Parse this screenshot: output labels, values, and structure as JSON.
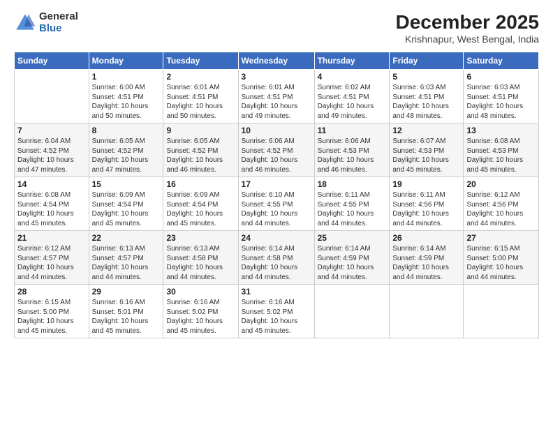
{
  "logo": {
    "general": "General",
    "blue": "Blue"
  },
  "header": {
    "month_year": "December 2025",
    "location": "Krishnapur, West Bengal, India"
  },
  "days_of_week": [
    "Sunday",
    "Monday",
    "Tuesday",
    "Wednesday",
    "Thursday",
    "Friday",
    "Saturday"
  ],
  "weeks": [
    [
      {
        "day": "",
        "info": ""
      },
      {
        "day": "1",
        "info": "Sunrise: 6:00 AM\nSunset: 4:51 PM\nDaylight: 10 hours\nand 50 minutes."
      },
      {
        "day": "2",
        "info": "Sunrise: 6:01 AM\nSunset: 4:51 PM\nDaylight: 10 hours\nand 50 minutes."
      },
      {
        "day": "3",
        "info": "Sunrise: 6:01 AM\nSunset: 4:51 PM\nDaylight: 10 hours\nand 49 minutes."
      },
      {
        "day": "4",
        "info": "Sunrise: 6:02 AM\nSunset: 4:51 PM\nDaylight: 10 hours\nand 49 minutes."
      },
      {
        "day": "5",
        "info": "Sunrise: 6:03 AM\nSunset: 4:51 PM\nDaylight: 10 hours\nand 48 minutes."
      },
      {
        "day": "6",
        "info": "Sunrise: 6:03 AM\nSunset: 4:51 PM\nDaylight: 10 hours\nand 48 minutes."
      }
    ],
    [
      {
        "day": "7",
        "info": "Sunrise: 6:04 AM\nSunset: 4:52 PM\nDaylight: 10 hours\nand 47 minutes."
      },
      {
        "day": "8",
        "info": "Sunrise: 6:05 AM\nSunset: 4:52 PM\nDaylight: 10 hours\nand 47 minutes."
      },
      {
        "day": "9",
        "info": "Sunrise: 6:05 AM\nSunset: 4:52 PM\nDaylight: 10 hours\nand 46 minutes."
      },
      {
        "day": "10",
        "info": "Sunrise: 6:06 AM\nSunset: 4:52 PM\nDaylight: 10 hours\nand 46 minutes."
      },
      {
        "day": "11",
        "info": "Sunrise: 6:06 AM\nSunset: 4:53 PM\nDaylight: 10 hours\nand 46 minutes."
      },
      {
        "day": "12",
        "info": "Sunrise: 6:07 AM\nSunset: 4:53 PM\nDaylight: 10 hours\nand 45 minutes."
      },
      {
        "day": "13",
        "info": "Sunrise: 6:08 AM\nSunset: 4:53 PM\nDaylight: 10 hours\nand 45 minutes."
      }
    ],
    [
      {
        "day": "14",
        "info": "Sunrise: 6:08 AM\nSunset: 4:54 PM\nDaylight: 10 hours\nand 45 minutes."
      },
      {
        "day": "15",
        "info": "Sunrise: 6:09 AM\nSunset: 4:54 PM\nDaylight: 10 hours\nand 45 minutes."
      },
      {
        "day": "16",
        "info": "Sunrise: 6:09 AM\nSunset: 4:54 PM\nDaylight: 10 hours\nand 45 minutes."
      },
      {
        "day": "17",
        "info": "Sunrise: 6:10 AM\nSunset: 4:55 PM\nDaylight: 10 hours\nand 44 minutes."
      },
      {
        "day": "18",
        "info": "Sunrise: 6:11 AM\nSunset: 4:55 PM\nDaylight: 10 hours\nand 44 minutes."
      },
      {
        "day": "19",
        "info": "Sunrise: 6:11 AM\nSunset: 4:56 PM\nDaylight: 10 hours\nand 44 minutes."
      },
      {
        "day": "20",
        "info": "Sunrise: 6:12 AM\nSunset: 4:56 PM\nDaylight: 10 hours\nand 44 minutes."
      }
    ],
    [
      {
        "day": "21",
        "info": "Sunrise: 6:12 AM\nSunset: 4:57 PM\nDaylight: 10 hours\nand 44 minutes."
      },
      {
        "day": "22",
        "info": "Sunrise: 6:13 AM\nSunset: 4:57 PM\nDaylight: 10 hours\nand 44 minutes."
      },
      {
        "day": "23",
        "info": "Sunrise: 6:13 AM\nSunset: 4:58 PM\nDaylight: 10 hours\nand 44 minutes."
      },
      {
        "day": "24",
        "info": "Sunrise: 6:14 AM\nSunset: 4:58 PM\nDaylight: 10 hours\nand 44 minutes."
      },
      {
        "day": "25",
        "info": "Sunrise: 6:14 AM\nSunset: 4:59 PM\nDaylight: 10 hours\nand 44 minutes."
      },
      {
        "day": "26",
        "info": "Sunrise: 6:14 AM\nSunset: 4:59 PM\nDaylight: 10 hours\nand 44 minutes."
      },
      {
        "day": "27",
        "info": "Sunrise: 6:15 AM\nSunset: 5:00 PM\nDaylight: 10 hours\nand 44 minutes."
      }
    ],
    [
      {
        "day": "28",
        "info": "Sunrise: 6:15 AM\nSunset: 5:00 PM\nDaylight: 10 hours\nand 45 minutes."
      },
      {
        "day": "29",
        "info": "Sunrise: 6:16 AM\nSunset: 5:01 PM\nDaylight: 10 hours\nand 45 minutes."
      },
      {
        "day": "30",
        "info": "Sunrise: 6:16 AM\nSunset: 5:02 PM\nDaylight: 10 hours\nand 45 minutes."
      },
      {
        "day": "31",
        "info": "Sunrise: 6:16 AM\nSunset: 5:02 PM\nDaylight: 10 hours\nand 45 minutes."
      },
      {
        "day": "",
        "info": ""
      },
      {
        "day": "",
        "info": ""
      },
      {
        "day": "",
        "info": ""
      }
    ]
  ]
}
